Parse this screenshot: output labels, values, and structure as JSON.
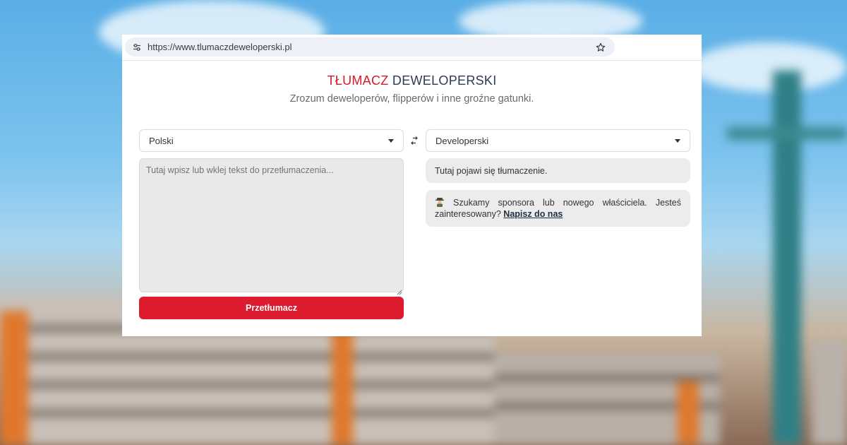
{
  "browser": {
    "url": "https://www.tlumaczdeweloperski.pl",
    "icons": {
      "site_settings": "tune-icon",
      "bookmark": "star-icon"
    }
  },
  "header": {
    "title_red": "TŁUMACZ",
    "title_rest": "DEWELOPERSKI",
    "subtitle": "Zrozum deweloperów, flipperów i inne groźne gatunki."
  },
  "translator": {
    "source_language": "Polski",
    "target_language": "Developerski",
    "input_placeholder": "Tutaj wpisz lub wklej tekst do przetłumaczenia...",
    "translate_button": "Przetłumacz",
    "output_placeholder": "Tutaj pojawi się tłumaczenie.",
    "icons": {
      "swap": "swap-icon",
      "dropdown": "caret-down-icon"
    }
  },
  "sponsor": {
    "words": [
      "Szukamy",
      "sponsora",
      "lub",
      "nowego",
      "właściciela.",
      "Jesteś"
    ],
    "line2": "zainteresowany?",
    "link": "Napisz do nas",
    "icon": "detective-icon"
  },
  "colors": {
    "accent_red": "#dc1c2e",
    "title_dark": "#2e3b4e"
  }
}
